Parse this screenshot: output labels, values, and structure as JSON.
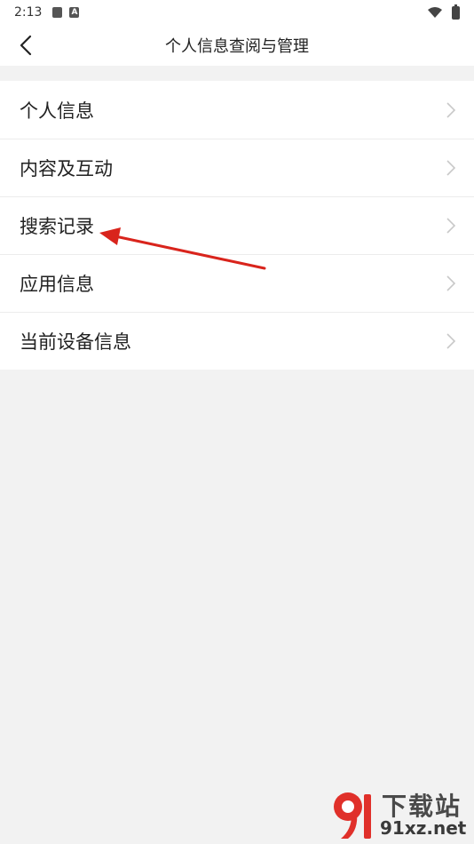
{
  "status_bar": {
    "time": "2:13",
    "notif_icon_label": "A"
  },
  "header": {
    "title": "个人信息查阅与管理"
  },
  "menu": {
    "items": [
      {
        "label": "个人信息"
      },
      {
        "label": "内容及互动"
      },
      {
        "label": "搜索记录"
      },
      {
        "label": "应用信息"
      },
      {
        "label": "当前设备信息"
      }
    ]
  },
  "watermark": {
    "top": "下载站",
    "bottom": "91xz.net"
  },
  "colors": {
    "annotation_arrow": "#d9241c",
    "background": "#f2f2f2",
    "watermark_red": "#e0302a"
  },
  "icons": [
    "back-arrow-icon",
    "chevron-right-icon",
    "wifi-icon",
    "battery-icon"
  ]
}
